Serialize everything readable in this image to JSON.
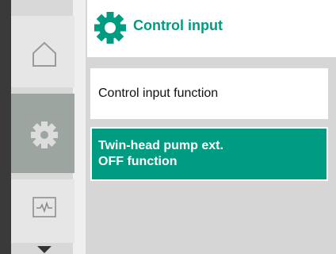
{
  "header": {
    "title": "Control input",
    "accent_color": "#009c82",
    "icon": "gear-icon"
  },
  "rail": {
    "items": [
      {
        "icon": "home-icon",
        "active": false
      },
      {
        "icon": "gear-icon",
        "active": true
      },
      {
        "icon": "trend-icon",
        "active": false
      }
    ],
    "scroll_indicator": "chevron-down-icon"
  },
  "menu": {
    "items": [
      {
        "lines": [
          "Control input function"
        ],
        "selected": false
      },
      {
        "lines": [
          "Twin-head pump ext.",
          "OFF function"
        ],
        "selected": true
      }
    ]
  }
}
